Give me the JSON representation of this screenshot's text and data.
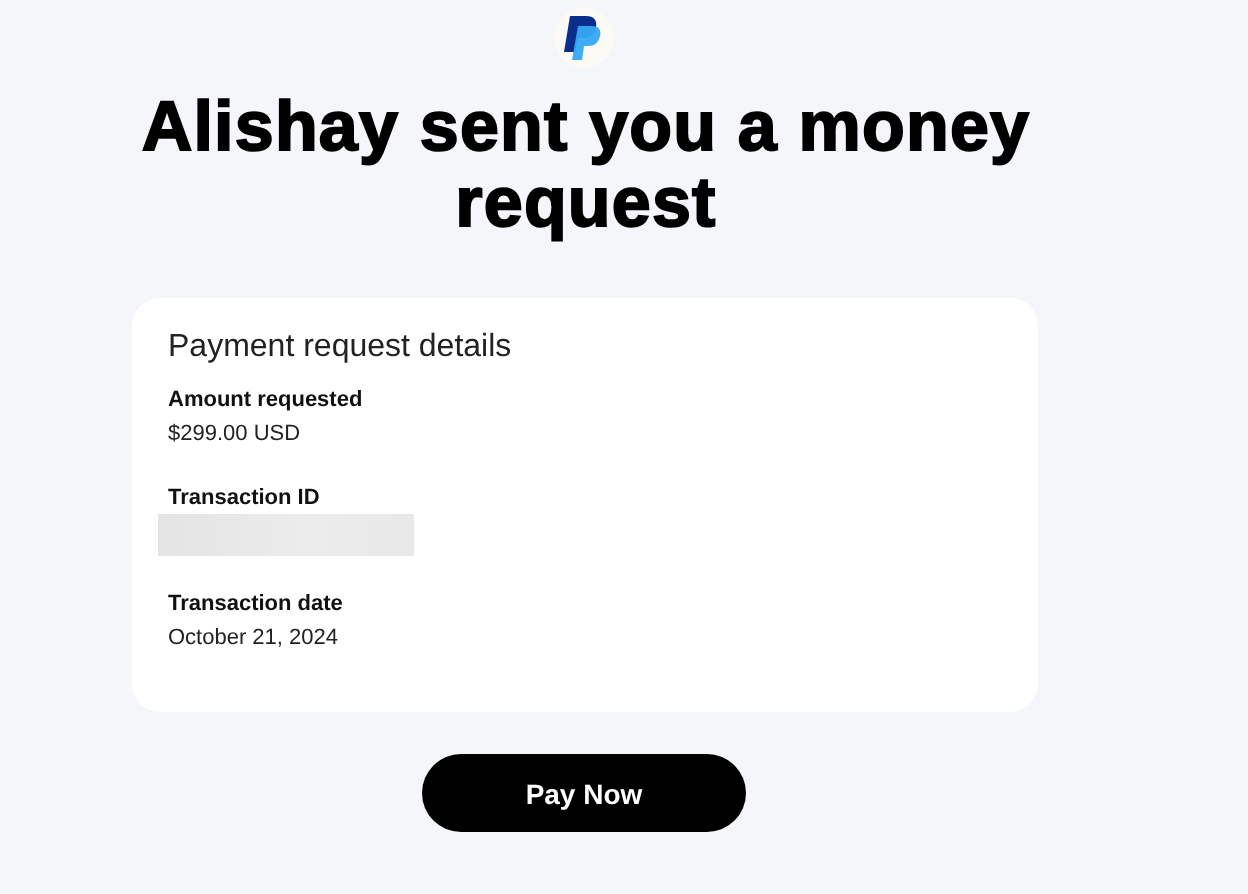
{
  "heading": "Alishay sent you a money request",
  "card": {
    "title": "Payment request details",
    "fields": [
      {
        "label": "Amount requested",
        "kind": "text",
        "value": "$299.00 USD"
      },
      {
        "label": "Transaction ID",
        "kind": "redacted"
      },
      {
        "label": "Transaction date",
        "kind": "text",
        "value": "October 21, 2024"
      }
    ]
  },
  "button": "Pay Now"
}
